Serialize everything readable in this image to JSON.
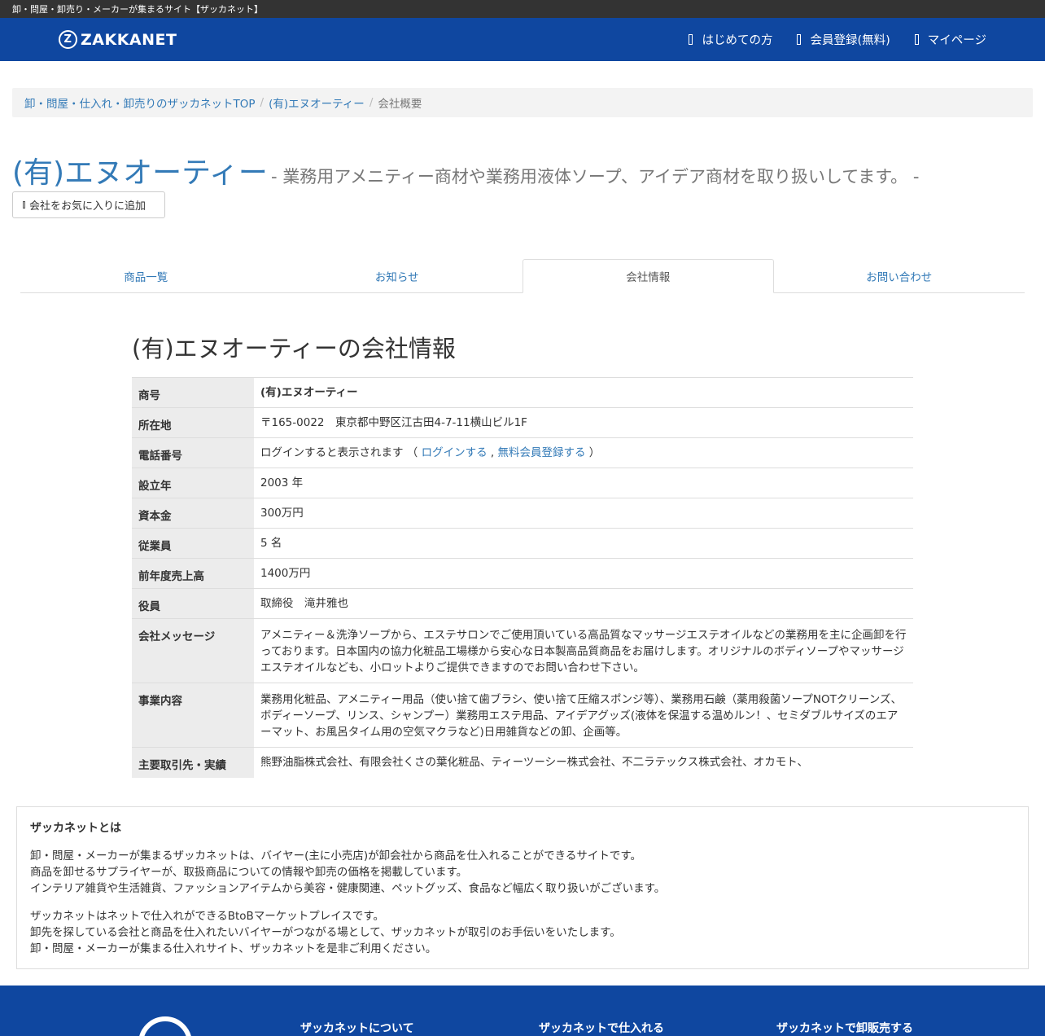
{
  "topbar": {
    "text": "卸・問屋・卸売り・メーカーが集まるサイト【ザッカネット】"
  },
  "header": {
    "logo_mark": "Z",
    "logo_text": "ZAKKANET",
    "nav": [
      {
        "label": "はじめての方"
      },
      {
        "label": "会員登録(無料)"
      },
      {
        "label": "マイページ"
      }
    ]
  },
  "breadcrumb": {
    "items": [
      {
        "label": "卸・問屋・仕入れ・卸売りのザッカネットTOP"
      },
      {
        "label": "(有)エヌオーティー"
      },
      {
        "label": "会社概要"
      }
    ],
    "separator": "/"
  },
  "company": {
    "name": "(有)エヌオーティー",
    "tagline": "- 業務用アメニティー商材や業務用液体ソープ、アイデア商材を取り扱いしてます。 -",
    "favorite_button": "会社をお気に入りに追加"
  },
  "tabs": [
    {
      "label": "商品一覧"
    },
    {
      "label": "お知らせ"
    },
    {
      "label": "会社情報"
    },
    {
      "label": "お問い合わせ"
    }
  ],
  "info": {
    "title": "(有)エヌオーティーの会社情報",
    "rows": [
      {
        "label": "商号",
        "value": "(有)エヌオーティー"
      },
      {
        "label": "所在地",
        "value": "〒165-0022　東京都中野区江古田4-7-11横山ビル1F"
      },
      {
        "label": "電話番号",
        "value": "ログインすると表示されます （",
        "login_link": "ログインする",
        "comma": ",",
        "register_link": "無料会員登録する",
        "close": "）"
      },
      {
        "label": "設立年",
        "value": "2003 年"
      },
      {
        "label": "資本金",
        "value": "300万円"
      },
      {
        "label": "従業員",
        "value": "5 名"
      },
      {
        "label": "前年度売上高",
        "value": "1400万円"
      },
      {
        "label": "役員",
        "value": "取締役　滝井雅也"
      },
      {
        "label": "会社メッセージ",
        "value": "アメニティー＆洗浄ソープから、エステサロンでご使用頂いている高品質なマッサージエステオイルなどの業務用を主に企画卸を行っております。日本国内の協力化粧品工場様から安心な日本製高品質商品をお届けします。オリジナルのボディソープやマッサージエステオイルなども、小ロットよりご提供できますのでお問い合わせ下さい。"
      },
      {
        "label": "事業内容",
        "value": "業務用化粧品、アメニティー用品（使い捨て歯ブラシ、使い捨て圧縮スポンジ等）、業務用石鹸（薬用殺菌ソープNOTクリーンズ、ボディーソープ、リンス、シャンプー）業務用エステ用品、アイデアグッズ(液体を保温する温めルン！、セミダブルサイズのエアーマット、お風呂タイム用の空気マクラなど)日用雑貨などの卸、企画等。"
      },
      {
        "label": "主要取引先・実績",
        "value": "熊野油脂株式会社、有限会社くさの葉化粧品、ティーツーシー株式会社、不二ラテックス株式会社、オカモト、"
      }
    ]
  },
  "about": {
    "title": "ザッカネットとは",
    "para1": [
      "卸・問屋・メーカーが集まるザッカネットは、バイヤー(主に小売店)が卸会社から商品を仕入れることができるサイトです。",
      "商品を卸せるサプライヤーが、取扱商品についての情報や卸売の価格を掲載しています。",
      "インテリア雑貨や生活雑貨、ファッションアイテムから美容・健康関連、ペットグッズ、食品など幅広く取り扱いがございます。"
    ],
    "para2": [
      "ザッカネットはネットで仕入れができるBtoBマーケットプレイスです。",
      "卸先を探している会社と商品を仕入れたいバイヤーがつながる場として、ザッカネットが取引のお手伝いをいたします。",
      "卸・問屋・メーカーが集まる仕入れサイト、ザッカネットを是非ご利用ください。"
    ]
  },
  "footer": {
    "columns": [
      {
        "label": "ザッカネットについて"
      },
      {
        "label": "ザッカネットで仕入れる"
      },
      {
        "label": "ザッカネットで卸販売する"
      }
    ]
  },
  "colors": {
    "header_bg": "#0f47a0",
    "link": "#337ab7",
    "topbar_bg": "#333333"
  }
}
